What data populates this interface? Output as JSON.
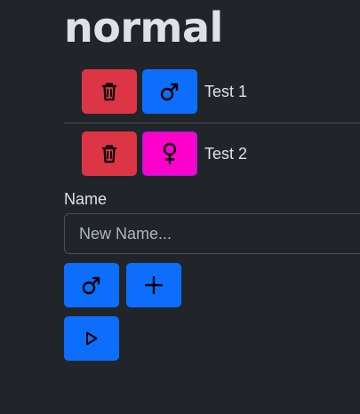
{
  "title": "normal",
  "colors": {
    "background": "#212529",
    "danger": "#dc3545",
    "primary": "#0d6efd",
    "pink": "#ff00cc"
  },
  "items": [
    {
      "name": "Test 1",
      "gender": "male",
      "delete_icon": "trash-icon",
      "gender_icon": "male-icon"
    },
    {
      "name": "Test 2",
      "gender": "female",
      "delete_icon": "trash-icon",
      "gender_icon": "female-icon"
    }
  ],
  "form": {
    "label": "Name",
    "placeholder": "New Name...",
    "value": "",
    "gender_icon": "male-icon",
    "add_icon": "plus-icon"
  },
  "controls": {
    "play_icon": "play-icon"
  }
}
